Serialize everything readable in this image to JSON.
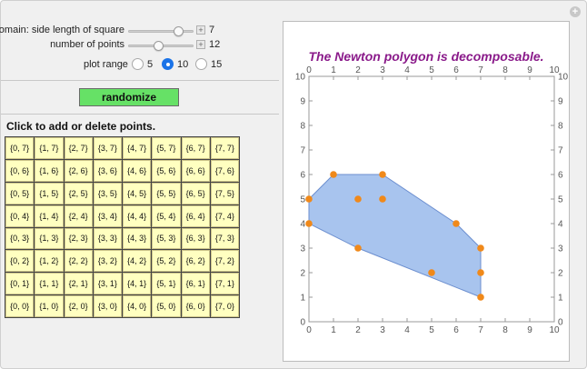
{
  "controls": {
    "domain": {
      "label": "domain: side length of square",
      "value": "7",
      "fraction": 0.8
    },
    "num_points": {
      "label": "number of points",
      "value": "12",
      "fraction": 0.45
    },
    "plot_range": {
      "label": "plot range",
      "options": [
        "5",
        "10",
        "15"
      ],
      "selected": "10"
    },
    "randomize_label": "randomize",
    "instruction": "Click to add or delete points."
  },
  "grid_rows": [
    [
      "{0, 7}",
      "{1, 7}",
      "{2, 7}",
      "{3, 7}",
      "{4, 7}",
      "{5, 7}",
      "{6, 7}",
      "{7, 7}"
    ],
    [
      "{0, 6}",
      "{1, 6}",
      "{2, 6}",
      "{3, 6}",
      "{4, 6}",
      "{5, 6}",
      "{6, 6}",
      "{7, 6}"
    ],
    [
      "{0, 5}",
      "{1, 5}",
      "{2, 5}",
      "{3, 5}",
      "{4, 5}",
      "{5, 5}",
      "{6, 5}",
      "{7, 5}"
    ],
    [
      "{0, 4}",
      "{1, 4}",
      "{2, 4}",
      "{3, 4}",
      "{4, 4}",
      "{5, 4}",
      "{6, 4}",
      "{7, 4}"
    ],
    [
      "{0, 3}",
      "{1, 3}",
      "{2, 3}",
      "{3, 3}",
      "{4, 3}",
      "{5, 3}",
      "{6, 3}",
      "{7, 3}"
    ],
    [
      "{0, 2}",
      "{1, 2}",
      "{2, 2}",
      "{3, 2}",
      "{4, 2}",
      "{5, 2}",
      "{6, 2}",
      "{7, 2}"
    ],
    [
      "{0, 1}",
      "{1, 1}",
      "{2, 1}",
      "{3, 1}",
      "{4, 1}",
      "{5, 1}",
      "{6, 1}",
      "{7, 1}"
    ],
    [
      "{0, 0}",
      "{1, 0}",
      "{2, 0}",
      "{3, 0}",
      "{4, 0}",
      "{5, 0}",
      "{6, 0}",
      "{7, 0}"
    ]
  ],
  "plot": {
    "title": "The Newton polygon is decomposable.",
    "range": [
      0,
      10
    ],
    "ticks": [
      0,
      1,
      2,
      3,
      4,
      5,
      6,
      7,
      8,
      9,
      10
    ],
    "points": [
      [
        0,
        5
      ],
      [
        1,
        6
      ],
      [
        3,
        6
      ],
      [
        0,
        4
      ],
      [
        2,
        5
      ],
      [
        3,
        5
      ],
      [
        6,
        4
      ],
      [
        7,
        3
      ],
      [
        2,
        3
      ],
      [
        7,
        2
      ],
      [
        5,
        2
      ],
      [
        7,
        1
      ]
    ],
    "hull": [
      [
        0,
        4
      ],
      [
        0,
        5
      ],
      [
        1,
        6
      ],
      [
        3,
        6
      ],
      [
        6,
        4
      ],
      [
        7,
        3
      ],
      [
        7,
        2
      ],
      [
        7,
        1
      ],
      [
        2,
        3
      ]
    ],
    "fill_color": "#a8c4ee",
    "edge_color": "#6b8ecf",
    "point_color": "#f0891a"
  }
}
